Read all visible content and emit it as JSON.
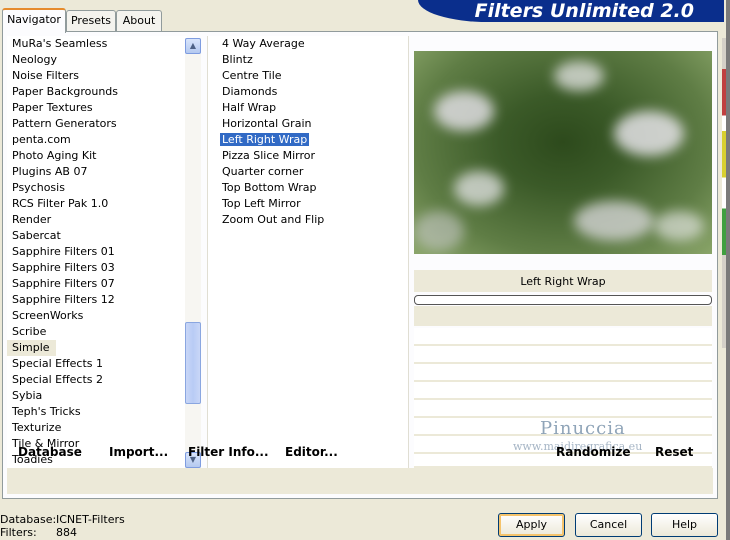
{
  "tabs": [
    "Navigator",
    "Presets",
    "About"
  ],
  "title": "Filters Unlimited 2.0",
  "categories": [
    "MuRa's Seamless",
    "Neology",
    "Noise Filters",
    "Paper Backgrounds",
    "Paper Textures",
    "Pattern Generators",
    "penta.com",
    "Photo Aging Kit",
    "Plugins AB 07",
    "Psychosis",
    "RCS Filter Pak 1.0",
    "Render",
    "Sabercat",
    "Sapphire Filters 01",
    "Sapphire Filters 03",
    "Sapphire Filters 07",
    "Sapphire Filters 12",
    "ScreenWorks",
    "Scribe",
    "Simple",
    "Special Effects 1",
    "Special Effects 2",
    "Sybia",
    "Teph's Tricks",
    "Texturize",
    "Tile & Mirror",
    "Toadies"
  ],
  "selected_category": "Simple",
  "filters": [
    "4 Way Average",
    "Blintz",
    "Centre Tile",
    "Diamonds",
    "Half Wrap",
    "Horizontal Grain",
    "Left Right Wrap",
    "Pizza Slice Mirror",
    "Quarter corner",
    "Top Bottom Wrap",
    "Top Left Mirror",
    "Zoom Out and Flip"
  ],
  "selected_filter": "Left Right Wrap",
  "preview": {
    "filter_name": "Left Right Wrap"
  },
  "watermark": {
    "name": "Pinuccia",
    "url": "www.maidiregrafica.eu"
  },
  "bottom_buttons": {
    "database": "Database",
    "import": "Import...",
    "filter_info": "Filter Info...",
    "editor": "Editor...",
    "randomize": "Randomize",
    "reset": "Reset"
  },
  "status": {
    "database_label": "Database:",
    "database_value": "ICNET-Filters",
    "filters_label": "Filters:",
    "filters_value": "884"
  },
  "dialog_buttons": {
    "apply": "Apply",
    "cancel": "Cancel",
    "help": "Help"
  },
  "icons": {
    "scroll_up": "chevron-up-icon",
    "scroll_down": "chevron-down-icon"
  },
  "colors": {
    "title_banner": "#0a2e8c",
    "selection": "#316ac5",
    "tab_highlight": "#e68b2c"
  }
}
